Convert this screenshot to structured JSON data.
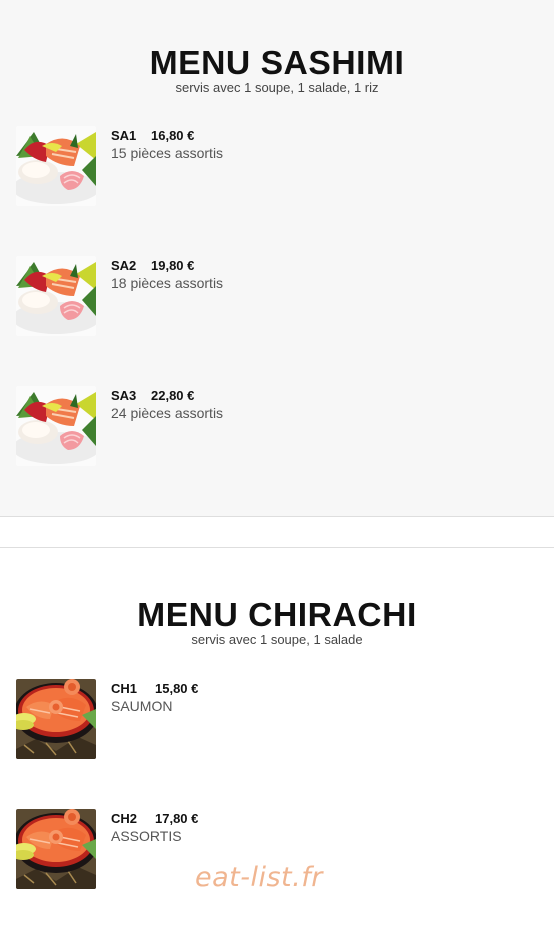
{
  "sashimi": {
    "title": "MENU SASHIMI",
    "subtitle": "servis avec 1 soupe, 1 salade, 1 riz",
    "items": [
      {
        "code": "SA1",
        "price": "16,80 €",
        "desc": "15 pièces assortis",
        "image": "sashimi-plate-image"
      },
      {
        "code": "SA2",
        "price": "19,80 €",
        "desc": "18 pièces assortis",
        "image": "sashimi-plate-image"
      },
      {
        "code": "SA3",
        "price": "22,80 €",
        "desc": "24 pièces assortis",
        "image": "sashimi-plate-image"
      }
    ]
  },
  "chirachi": {
    "title": "MENU CHIRACHI",
    "subtitle": "servis avec 1 soupe, 1 salade",
    "items": [
      {
        "code": "CH1",
        "price": "15,80 €",
        "desc": "SAUMON",
        "image": "chirashi-bowl-image"
      },
      {
        "code": "CH2",
        "price": "17,80 €",
        "desc": "ASSORTIS",
        "image": "chirashi-bowl-image"
      }
    ]
  },
  "watermark": "eat-list.fr",
  "colors": {
    "section_bg": "#f7f7f7",
    "divider": "#dedede",
    "watermark": "#f0b590"
  }
}
